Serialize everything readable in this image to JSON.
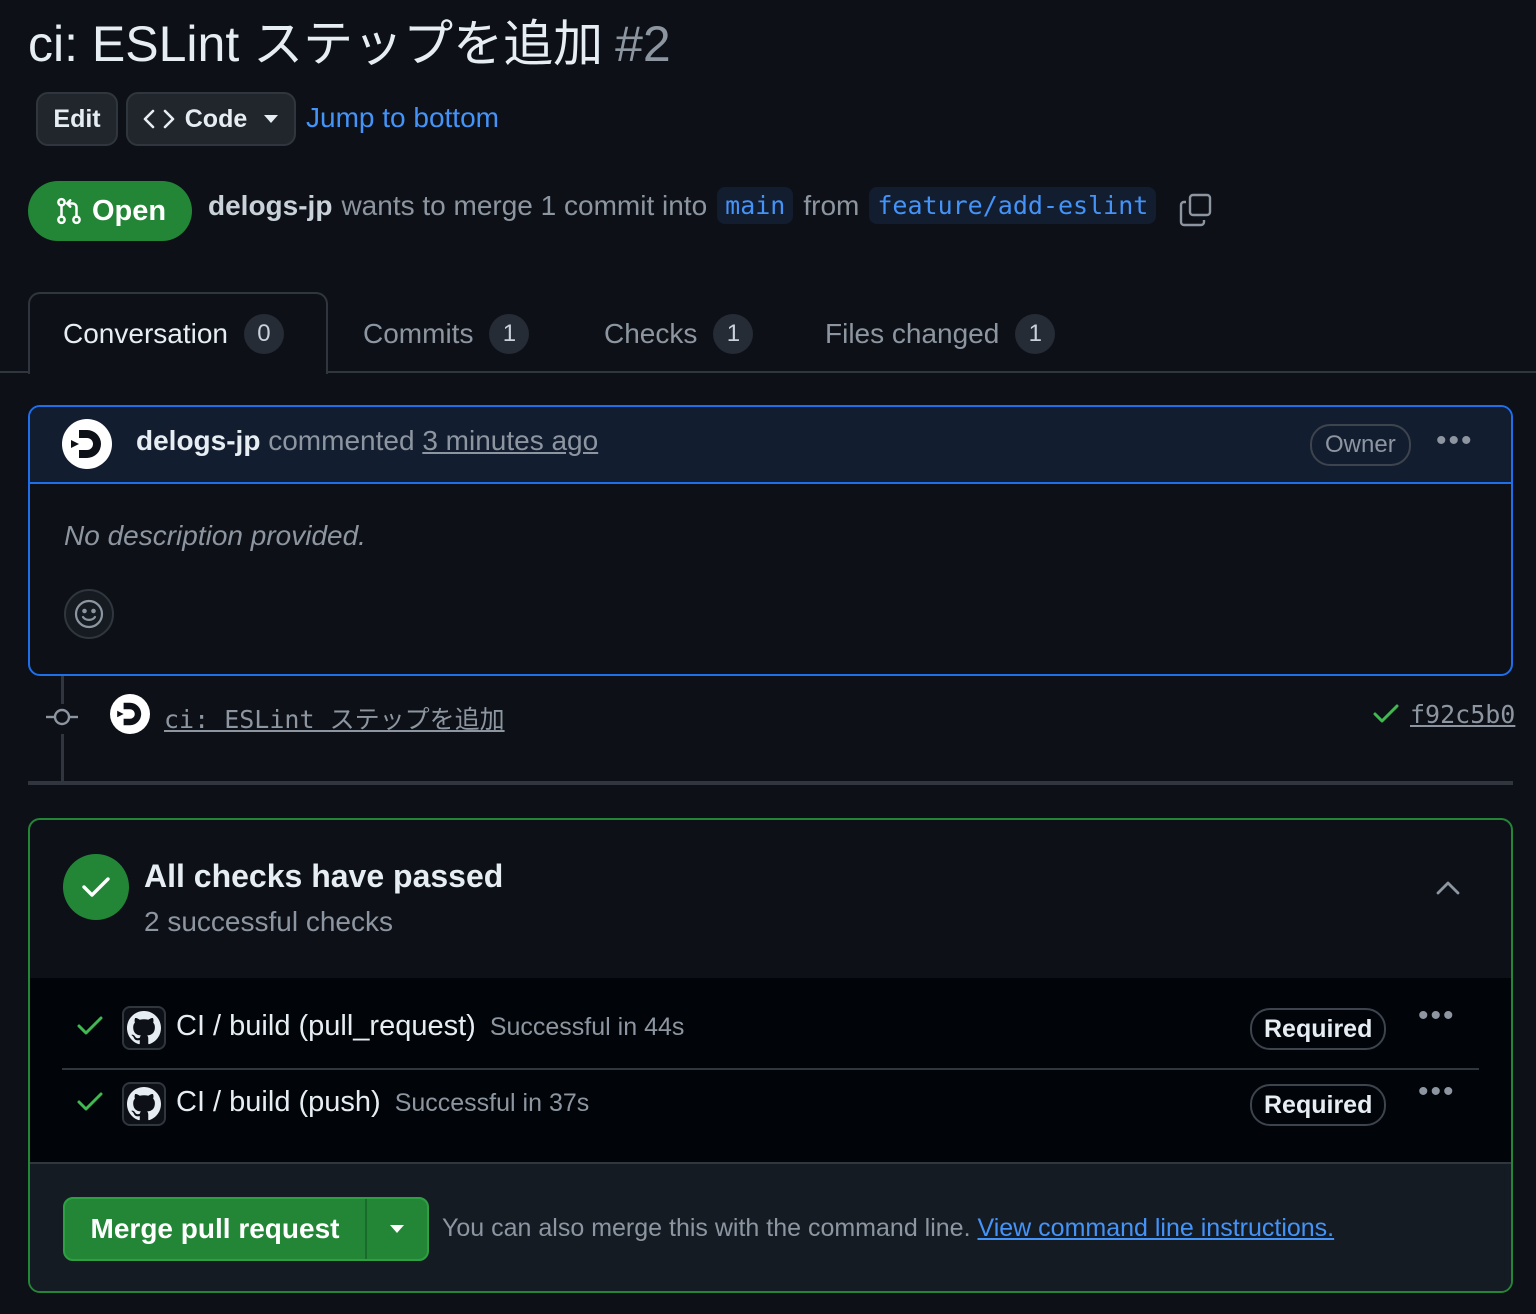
{
  "pr": {
    "title": "ci: ESLint ステップを追加",
    "number": "#2",
    "state": "Open",
    "author": "delogs-jp",
    "merge_text": "wants to merge 1 commit into",
    "base_branch": "main",
    "from_text": "from",
    "head_branch": "feature/add-eslint"
  },
  "header": {
    "edit_label": "Edit",
    "code_label": "Code",
    "jump_label": "Jump to bottom"
  },
  "tabs": [
    {
      "label": "Conversation",
      "count": "0"
    },
    {
      "label": "Commits",
      "count": "1"
    },
    {
      "label": "Checks",
      "count": "1"
    },
    {
      "label": "Files changed",
      "count": "1"
    }
  ],
  "comment": {
    "author": "delogs-jp",
    "action": "commented",
    "time": "3 minutes ago",
    "role": "Owner",
    "body": "No description provided."
  },
  "commit": {
    "message": "ci: ESLint ステップを追加",
    "sha": "f92c5b0"
  },
  "checks": {
    "title": "All checks have passed",
    "subtitle": "2 successful checks",
    "items": [
      {
        "name": "CI / build (pull_request)",
        "status": "Successful in 44s",
        "badge": "Required"
      },
      {
        "name": "CI / build (push)",
        "status": "Successful in 37s",
        "badge": "Required"
      }
    ]
  },
  "merge": {
    "button_label": "Merge pull request",
    "help_text": "You can also merge this with the command line.",
    "help_link": "View command line instructions."
  },
  "colors": {
    "background": "#0d1117",
    "accent_green": "#238636",
    "link_blue": "#4493f8"
  }
}
